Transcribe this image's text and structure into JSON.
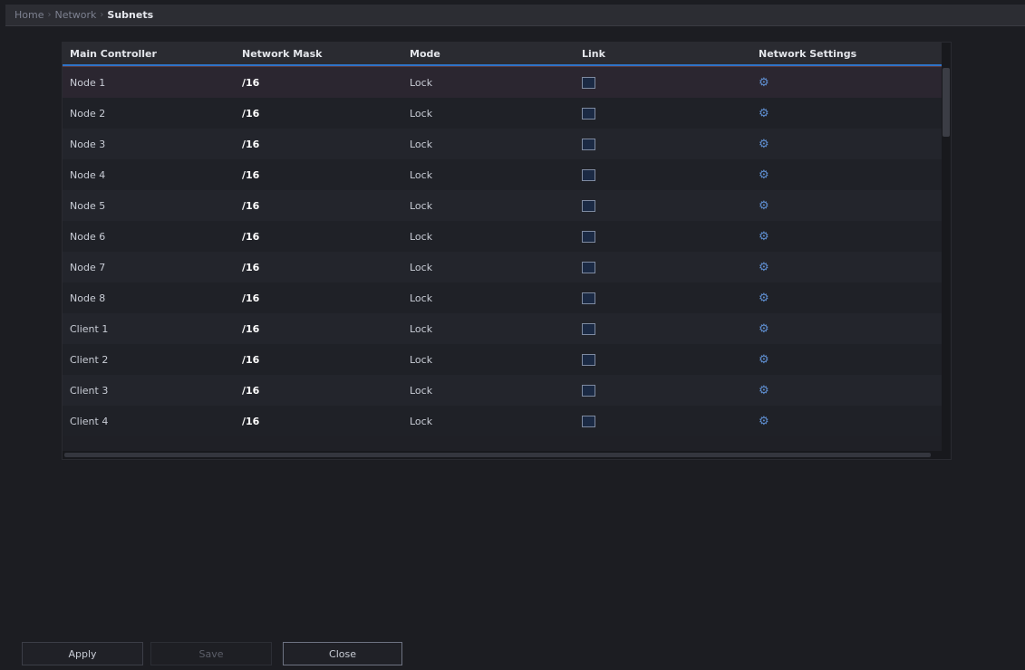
{
  "breadcrumb": [
    "Home",
    "Network",
    "Subnets"
  ],
  "table": {
    "columns": [
      "Main Controller",
      "Network Mask",
      "Mode",
      "Link",
      "Network Settings"
    ],
    "rows": [
      {
        "name": "Node 1",
        "mask": "/16",
        "mode": "Lock"
      },
      {
        "name": "Node 2",
        "mask": "/16",
        "mode": "Lock"
      },
      {
        "name": "Node 3",
        "mask": "/16",
        "mode": "Lock"
      },
      {
        "name": "Node 4",
        "mask": "/16",
        "mode": "Lock"
      },
      {
        "name": "Node 5",
        "mask": "/16",
        "mode": "Lock"
      },
      {
        "name": "Node 6",
        "mask": "/16",
        "mode": "Lock"
      },
      {
        "name": "Node 7",
        "mask": "/16",
        "mode": "Lock"
      },
      {
        "name": "Node 8",
        "mask": "/16",
        "mode": "Lock"
      },
      {
        "name": "Client 1",
        "mask": "/16",
        "mode": "Lock"
      },
      {
        "name": "Client 2",
        "mask": "/16",
        "mode": "Lock"
      },
      {
        "name": "Client 3",
        "mask": "/16",
        "mode": "Lock"
      },
      {
        "name": "Client 4",
        "mask": "/16",
        "mode": "Lock"
      }
    ]
  },
  "buttons": {
    "apply": "Apply",
    "save": "Save",
    "close": "Close"
  },
  "icons": {
    "link": "checkbox-icon",
    "settings": "gear-icon"
  },
  "colors": {
    "accent": "#2f73c7",
    "background": "#1c1d22"
  }
}
